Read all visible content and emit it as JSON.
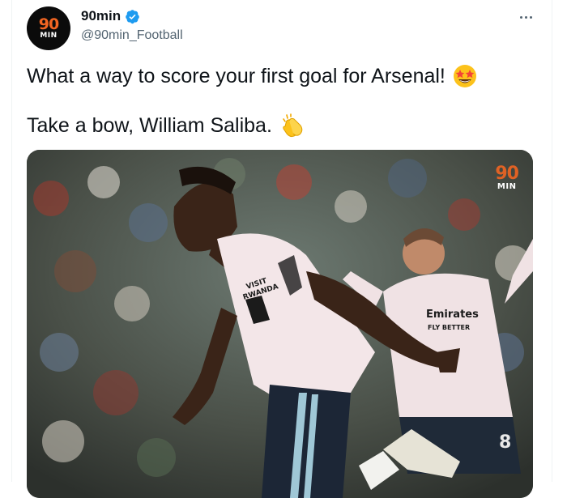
{
  "account": {
    "display_name": "90min",
    "handle": "@90min_Football",
    "verified": true,
    "avatar_logo": {
      "top": "90",
      "bottom": "MIN"
    }
  },
  "tweet": {
    "line1": "What a way to score your first goal for Arsenal!",
    "line2": "Take a bow, William Saliba."
  },
  "media": {
    "watermark": {
      "top": "90",
      "bottom": "MIN"
    },
    "sponsor_text_1": "VISIT",
    "sponsor_text_2": "RWANDA",
    "shirt_text": "Emirates",
    "shirt_text_2": "FLY BETTER",
    "shorts_number": "8"
  },
  "icons": {
    "verified": "verified-badge-icon",
    "more": "more-options-icon",
    "emoji1": "star-struck-emoji-icon",
    "emoji2": "clapping-hands-emoji-icon"
  },
  "colors": {
    "brand_orange": "#f26522",
    "verified_blue": "#1d9bf0",
    "text_primary": "#0f1419",
    "text_secondary": "#536471"
  }
}
